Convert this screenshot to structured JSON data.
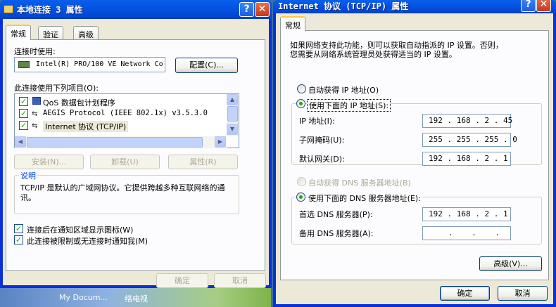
{
  "left_dialog": {
    "title": "本地连接 3 属性",
    "help_btn": "?",
    "close_btn": "✕",
    "tabs": [
      "常规",
      "验证",
      "高级"
    ],
    "connect_using_label": "连接时使用:",
    "adapter_name": "Intel(R) PRO/100 VE Network Co",
    "configure_btn": "配置(C)...",
    "items_label": "此连接使用下列项目(O):",
    "items": [
      {
        "label": "QoS 数据包计划程序",
        "checked": true
      },
      {
        "label": "AEGIS Protocol (IEEE 802.1x) v3.5.3.0",
        "checked": true
      },
      {
        "label": "Internet 协议 (TCP/IP)",
        "checked": true
      }
    ],
    "install_btn": "安装(N)...",
    "uninstall_btn": "卸载(U)",
    "properties_btn": "属性(R)",
    "description_title": "说明",
    "description_text": "TCP/IP 是默认的广域网协议。它提供跨越多种互联网络的通讯。",
    "show_icon_label": "连接后在通知区域显示图标(W)",
    "notify_label": "此连接被限制或无连接时通知我(M)",
    "ok_btn": "确定",
    "cancel_btn": "取消"
  },
  "right_dialog": {
    "title": "Internet 协议 (TCP/IP) 属性",
    "help_btn": "?",
    "close_btn": "✕",
    "tab": "常规",
    "intro_line1": "如果网络支持此功能，则可以获取自动指派的 IP 设置。否则，",
    "intro_line2": "您需要从网络系统管理员处获得适当的 IP 设置。",
    "auto_ip_label": "自动获得 IP 地址(O)",
    "manual_ip_label": "使用下面的 IP 地址(S):",
    "ip_label": "IP 地址(I):",
    "ip_value": "192 . 168 . 2 . 45",
    "subnet_label": "子网掩码(U):",
    "subnet_value": "255 . 255 . 255 . 0",
    "gateway_label": "默认网关(D):",
    "gateway_value": "192 . 168 . 2 . 1",
    "auto_dns_label": "自动获得 DNS 服务器地址(B)",
    "manual_dns_label": "使用下面的 DNS 服务器地址(E):",
    "pref_dns_label": "首选 DNS 服务器(P):",
    "pref_dns_value": "192 . 168 . 2 . 1",
    "alt_dns_label": "备用 DNS 服务器(A):",
    "alt_dns_value": ". . .",
    "advanced_btn": "高级(V)...",
    "ok_btn": "确定",
    "cancel_btn": "取消"
  },
  "desktop": {
    "icon1_label": "My Docum...",
    "icon2_label": "络电视"
  }
}
